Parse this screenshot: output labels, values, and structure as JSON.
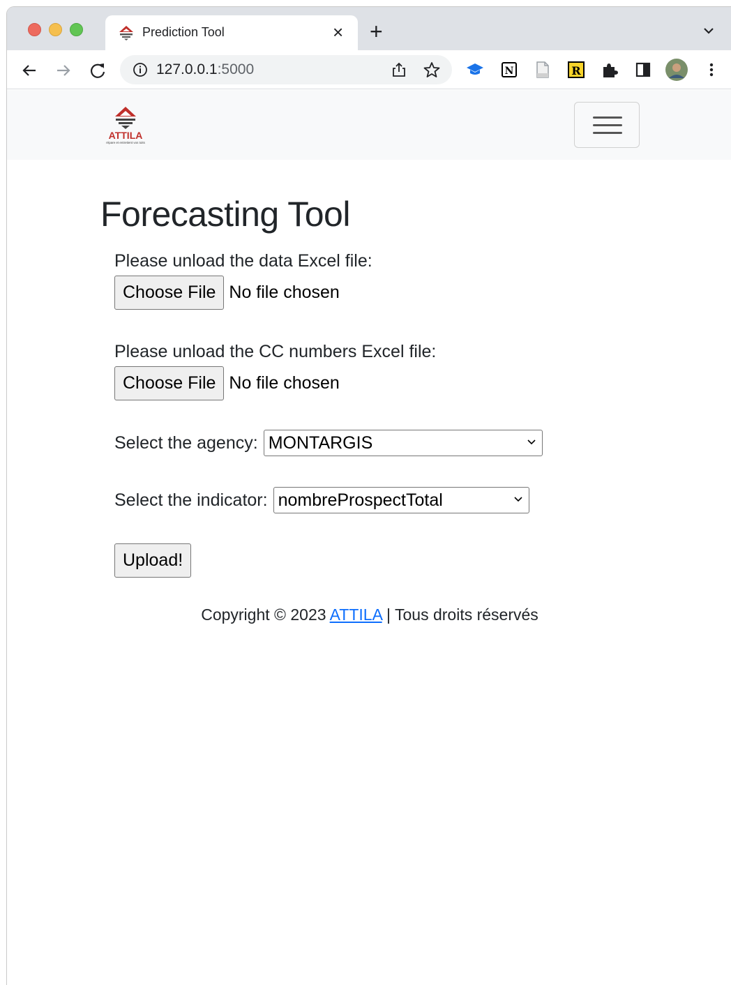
{
  "browser": {
    "tab_title": "Prediction Tool",
    "tab_close": "×",
    "new_tab": "+",
    "url_host": "127.0.0.1",
    "url_port": ":5000",
    "icons": [
      "back-arrow-icon",
      "forward-arrow-icon",
      "reload-icon",
      "info-icon",
      "share-icon",
      "star-icon",
      "graduation-cap-icon",
      "notion-icon",
      "document-icon",
      "r-extension-icon",
      "puzzle-icon",
      "side-panel-icon",
      "profile-avatar",
      "more-vert-icon"
    ]
  },
  "navbar": {
    "logo_text": "ATTILA",
    "logo_tagline": "répare et entretient vos toits"
  },
  "page": {
    "title": "Forecasting Tool"
  },
  "form": {
    "data_file_label": "Please unload the data Excel file:",
    "data_file_button": "Choose File",
    "data_file_status": "No file chosen",
    "cc_file_label": "Please unload the CC numbers Excel file:",
    "cc_file_button": "Choose File",
    "cc_file_status": "No file chosen",
    "agency_label": "Select the agency:",
    "agency_value": "MONTARGIS",
    "indicator_label": "Select the indicator:",
    "indicator_value": "nombreProspectTotal",
    "upload_button": "Upload!"
  },
  "footer": {
    "prefix": "Copyright © 2023",
    "link": "ATTILA",
    "suffix": "| Tous droits réservés"
  },
  "colors": {
    "brand_red": "#c0302b",
    "link_blue": "#0d6efd"
  }
}
